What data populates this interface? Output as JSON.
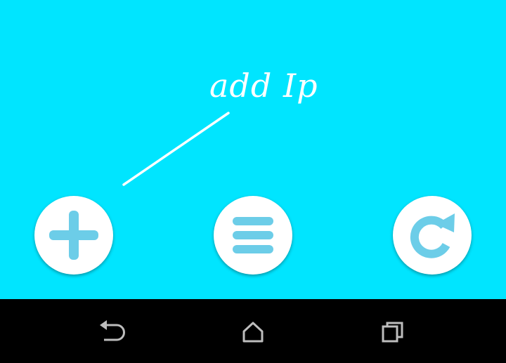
{
  "content": {
    "hint_label": "add Ip",
    "background_color": "#00e5ff"
  },
  "buttons": [
    {
      "name": "add",
      "icon": "plus-icon",
      "color": "#6ccde8"
    },
    {
      "name": "menu",
      "icon": "hamburger-icon",
      "color": "#6ccde8"
    },
    {
      "name": "refresh",
      "icon": "refresh-icon",
      "color": "#6ccde8"
    }
  ],
  "nav_bar": {
    "background_color": "#000000",
    "items": [
      {
        "name": "back",
        "icon": "back-icon"
      },
      {
        "name": "home",
        "icon": "home-icon"
      },
      {
        "name": "recents",
        "icon": "recents-icon"
      }
    ]
  }
}
